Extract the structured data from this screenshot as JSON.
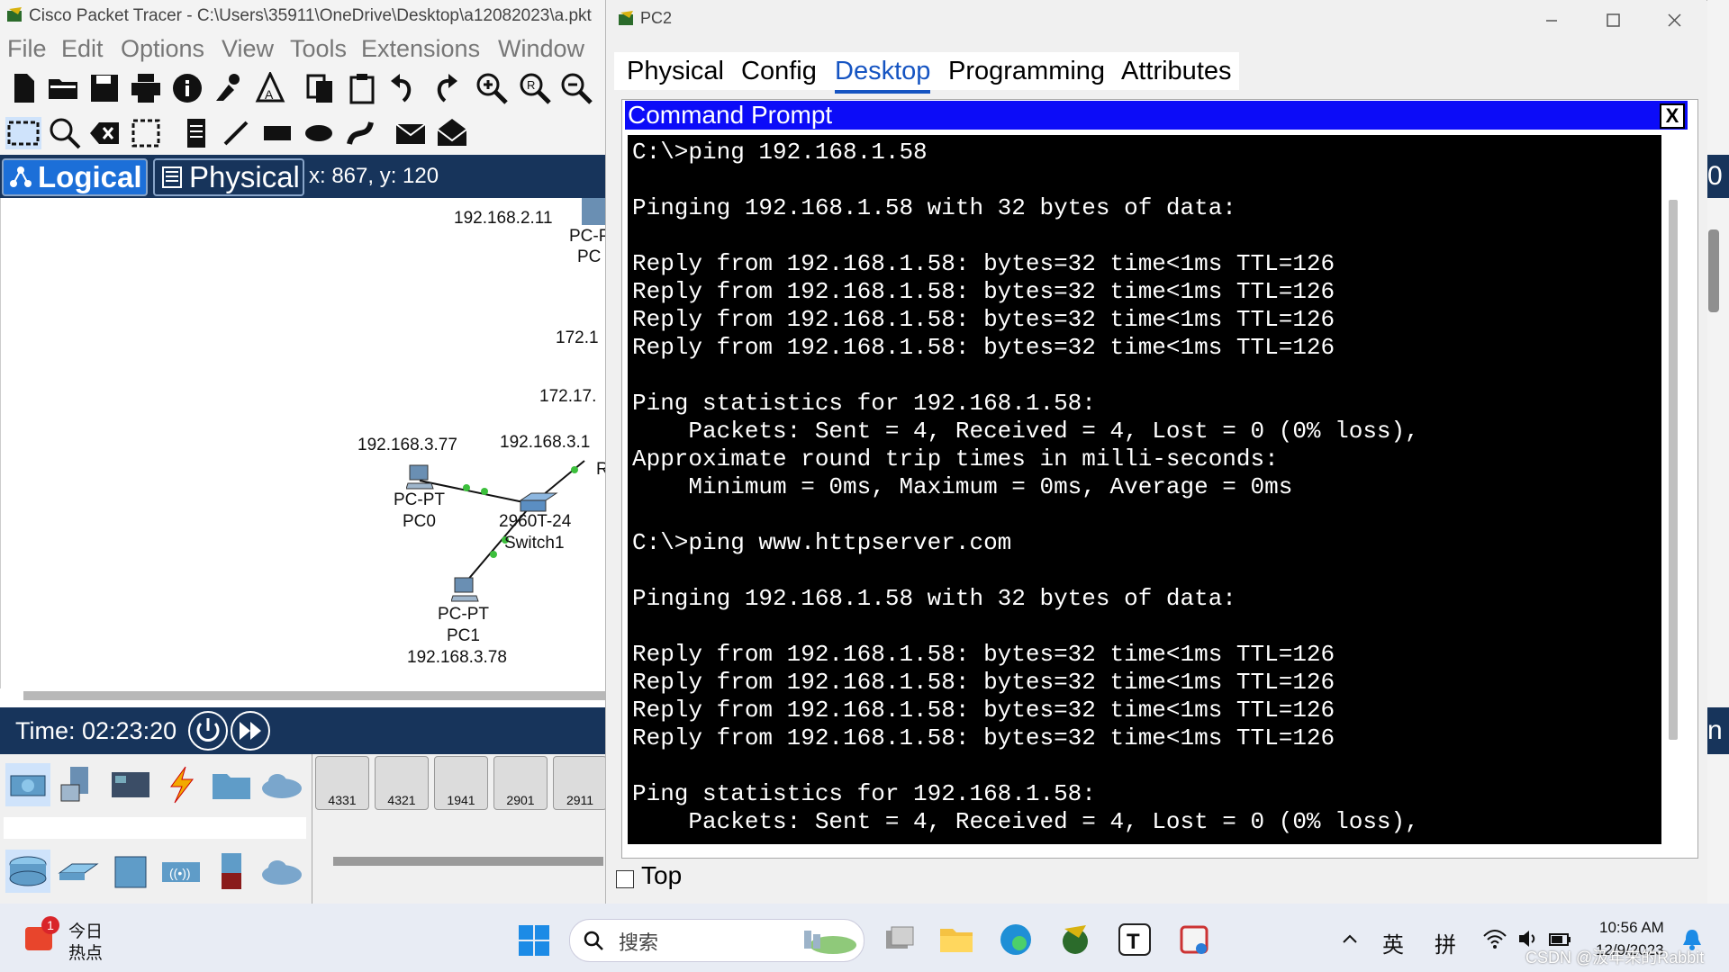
{
  "main_window": {
    "title": "Cisco Packet Tracer - C:\\Users\\35911\\OneDrive\\Desktop\\a12082023\\a.pkt",
    "menu": [
      "File",
      "Edit",
      "Options",
      "View",
      "Tools",
      "Extensions",
      "Window"
    ],
    "view_tabs": {
      "logical": "Logical",
      "physical": "Physical"
    },
    "coordinates": "x: 867, y: 120",
    "time": "Time: 02:23:20",
    "network_labels": {
      "ip_pc_top": "192.168.2.11",
      "pc_top_type": "PC-P",
      "pc_top_name": "PC",
      "ip_172_a": "172.1",
      "ip_172_b": "172.17.",
      "pc0_ip": "192.168.3.77",
      "gateway_ip": "192.168.3.1",
      "router_letter": "R",
      "pc0_type": "PC-PT",
      "pc0_name": "PC0",
      "switch_model": "2960T-24",
      "switch_name": "Switch1",
      "pc1_type": "PC-PT",
      "pc1_name": "PC1",
      "pc1_ip": "192.168.3.78"
    },
    "router_models": [
      "4331",
      "4321",
      "1941",
      "2901",
      "2911"
    ],
    "right_edge_glyphs": [
      "0",
      "n"
    ]
  },
  "pc2_window": {
    "title": "PC2",
    "tabs": [
      "Physical",
      "Config",
      "Desktop",
      "Programming",
      "Attributes"
    ],
    "active_tab": "Desktop",
    "command_prompt": {
      "title": "Command Prompt",
      "close_label": "X",
      "lines": [
        "C:\\>ping 192.168.1.58",
        "",
        "Pinging 192.168.1.58 with 32 bytes of data:",
        "",
        "Reply from 192.168.1.58: bytes=32 time<1ms TTL=126",
        "Reply from 192.168.1.58: bytes=32 time<1ms TTL=126",
        "Reply from 192.168.1.58: bytes=32 time<1ms TTL=126",
        "Reply from 192.168.1.58: bytes=32 time<1ms TTL=126",
        "",
        "Ping statistics for 192.168.1.58:",
        "    Packets: Sent = 4, Received = 4, Lost = 0 (0% loss),",
        "Approximate round trip times in milli-seconds:",
        "    Minimum = 0ms, Maximum = 0ms, Average = 0ms",
        "",
        "C:\\>ping www.httpserver.com",
        "",
        "Pinging 192.168.1.58 with 32 bytes of data:",
        "",
        "Reply from 192.168.1.58: bytes=32 time<1ms TTL=126",
        "Reply from 192.168.1.58: bytes=32 time<1ms TTL=126",
        "Reply from 192.168.1.58: bytes=32 time<1ms TTL=126",
        "Reply from 192.168.1.58: bytes=32 time<1ms TTL=126",
        "",
        "Ping statistics for 192.168.1.58:",
        "    Packets: Sent = 4, Received = 4, Lost = 0 (0% loss),"
      ]
    },
    "top_checkbox": {
      "label": "Top",
      "checked": false
    }
  },
  "taskbar": {
    "news_badge": "1",
    "news_line1": "今日",
    "news_line2": "热点",
    "search_placeholder": "搜索",
    "ime_lang": "英",
    "ime_mode": "拼",
    "time": "10:56 AM",
    "date": "12/9/2023",
    "watermark": "CSDN @汲年来的Rabbit"
  },
  "colors": {
    "cp_title_bar": "#0c0cf8",
    "pc_view_bar": "#17345b",
    "logical_button": "#1c6fd8",
    "active_tab": "#1554c2"
  }
}
